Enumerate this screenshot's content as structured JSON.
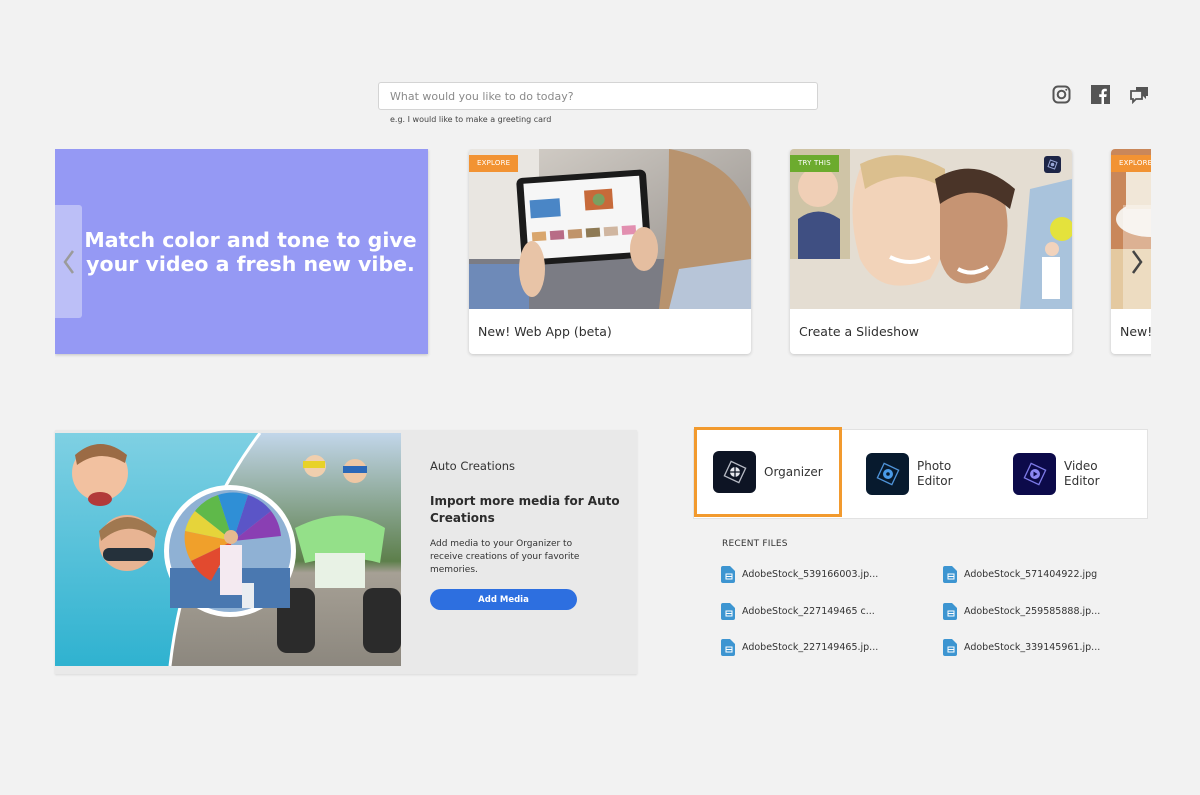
{
  "search": {
    "placeholder": "What would you like to do today?",
    "value": "",
    "hint": "e.g. I would like to make a greeting card"
  },
  "social": [
    {
      "name": "instagram-icon"
    },
    {
      "name": "facebook-icon"
    },
    {
      "name": "feedback-icon"
    }
  ],
  "carousel": {
    "hero_text": "Match color and tone to give your video a fresh new vibe.",
    "hero_color": "#9599f4",
    "cards": [
      {
        "badge": "EXPLORE",
        "label": "New! Web App (beta)"
      },
      {
        "badge": "TRY THIS",
        "label": "Create a Slideshow"
      },
      {
        "badge": "EXPLORE",
        "label": "New! Photo Editor"
      }
    ]
  },
  "auto_creations": {
    "heading": "Auto Creations",
    "title": "Import more media for Auto Creations",
    "description": "Add media to your Organizer to receive creations of your favorite memories.",
    "button_label": "Add Media",
    "button_color": "#2d6fe0"
  },
  "apps": [
    {
      "label": "Organizer",
      "selected": true
    },
    {
      "label_line1": "Photo",
      "label_line2": "Editor"
    },
    {
      "label_line1": "Video",
      "label_line2": "Editor"
    }
  ],
  "recent_files": {
    "title": "RECENT FILES",
    "files": [
      "AdobeStock_539166003.jp...",
      "AdobeStock_571404922.jpg",
      "AdobeStock_227149465 c...",
      "AdobeStock_259585888.jp...",
      "AdobeStock_227149465.jp...",
      "AdobeStock_339145961.jp..."
    ]
  },
  "colors": {
    "selection_outline": "#f29a2e",
    "badge_explore": "#f29333",
    "badge_try": "#6cab2e"
  }
}
